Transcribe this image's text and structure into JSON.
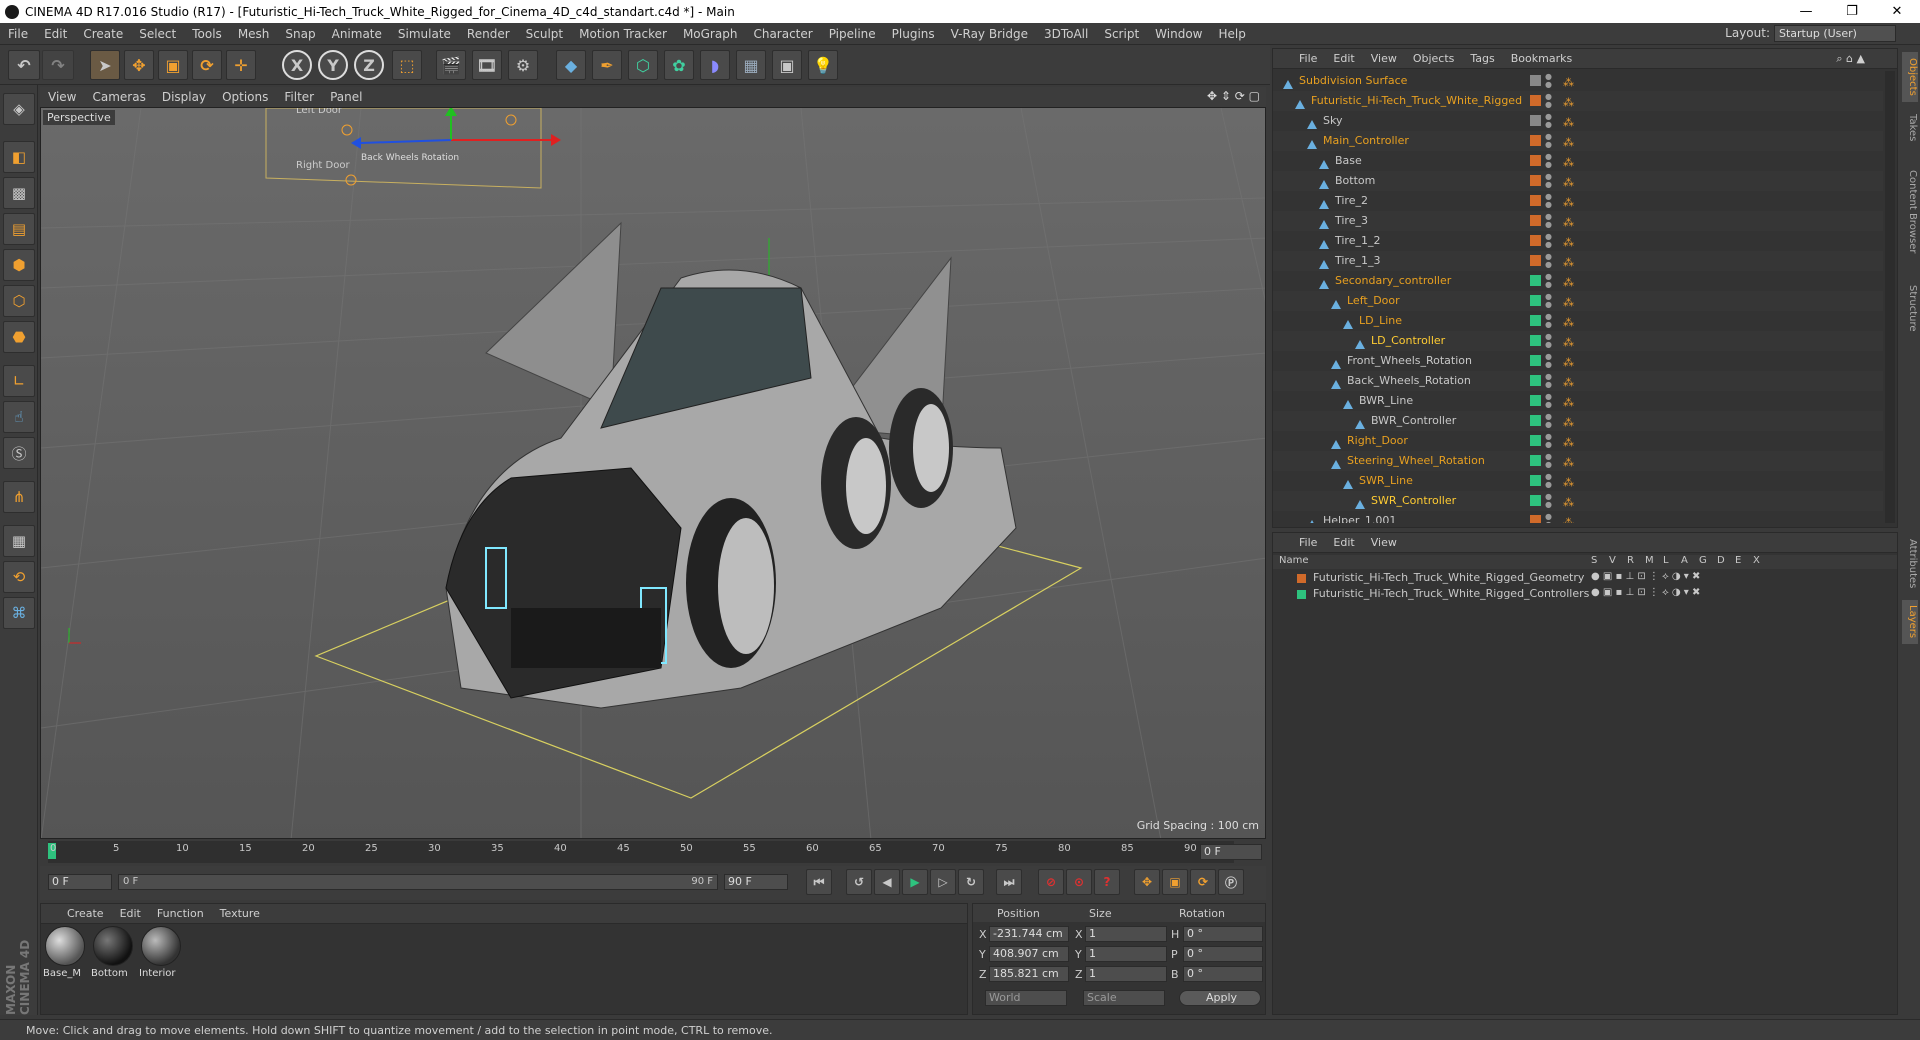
{
  "titlebar": {
    "title": "CINEMA 4D R17.016 Studio (R17) - [Futuristic_Hi-Tech_Truck_White_Rigged_for_Cinema_4D_c4d_standart.c4d *] - Main",
    "minimize": "—",
    "maximize": "❐",
    "close": "✕"
  },
  "menubar": {
    "items": [
      "File",
      "Edit",
      "Create",
      "Select",
      "Tools",
      "Mesh",
      "Snap",
      "Animate",
      "Simulate",
      "Render",
      "Sculpt",
      "Motion Tracker",
      "MoGraph",
      "Character",
      "Pipeline",
      "Plugins",
      "V-Ray Bridge",
      "3DToAll",
      "Script",
      "Window",
      "Help"
    ],
    "layout_label": "Layout:",
    "layout_value": "Startup (User)"
  },
  "toolbar": {
    "icons": [
      "undo-icon",
      "redo-icon",
      "select-arrow-icon",
      "move-icon",
      "scale-icon",
      "rotate-icon",
      "live-select-icon",
      "x-axis-icon",
      "y-axis-icon",
      "z-axis-icon",
      "world-coord-icon",
      "render-view-icon",
      "render-picture-icon",
      "render-settings-icon",
      "cube-icon",
      "pen-icon",
      "subdivision-icon",
      "mograph-icon",
      "deformer-icon",
      "floor-icon",
      "camera-icon",
      "light-icon"
    ],
    "x_label": "X",
    "y_label": "Y",
    "z_label": "Z"
  },
  "viewport": {
    "menu": [
      "View",
      "Cameras",
      "Display",
      "Options",
      "Filter",
      "Panel"
    ],
    "label": "Perspective",
    "grid_spacing": "Grid Spacing : 100 cm",
    "hud_text_1": "Left Door",
    "hud_text_2": "Right Door",
    "hud_text_3": "Back Wheels Rotation"
  },
  "timeline": {
    "ticks": [
      "0",
      "5",
      "10",
      "15",
      "20",
      "25",
      "30",
      "35",
      "40",
      "45",
      "50",
      "55",
      "60",
      "65",
      "70",
      "75",
      "80",
      "85",
      "90"
    ],
    "current_frame": "0 F"
  },
  "transport": {
    "start_field": "0 F",
    "range_start": "0 F",
    "range_end": "90 F",
    "end_field": "90 F"
  },
  "materials": {
    "menu": [
      "Create",
      "Edit",
      "Function",
      "Texture"
    ],
    "items": [
      {
        "name": "Base_M",
        "color": "#8a8a8a"
      },
      {
        "name": "Bottom",
        "color": "#1e1e1e"
      },
      {
        "name": "Interior",
        "color": "#6a6a6a"
      }
    ]
  },
  "coords": {
    "headers": {
      "position": "Position",
      "size": "Size",
      "rotation": "Rotation"
    },
    "rows": [
      {
        "axis": "X",
        "pos": "-231.744 cm",
        "size_axis": "X",
        "size": "1",
        "rot_axis": "H",
        "rot": "0 °"
      },
      {
        "axis": "Y",
        "pos": "408.907 cm",
        "size_axis": "Y",
        "size": "1",
        "rot_axis": "P",
        "rot": "0 °"
      },
      {
        "axis": "Z",
        "pos": "185.821 cm",
        "size_axis": "Z",
        "size": "1",
        "rot_axis": "B",
        "rot": "0 °"
      }
    ],
    "mode": "World",
    "scale": "Scale",
    "apply": "Apply"
  },
  "objects": {
    "menu": [
      "File",
      "Edit",
      "View",
      "Objects",
      "Tags",
      "Bookmarks"
    ],
    "rows": [
      {
        "name": "Subdivision Surface",
        "indent": 0,
        "color": "#e8a020",
        "layer": "#888888"
      },
      {
        "name": "Futuristic_Hi-Tech_Truck_White_Rigged",
        "indent": 1,
        "color": "#e8a020",
        "layer": "#d06a2a"
      },
      {
        "name": "Sky",
        "indent": 2,
        "color": "#c8c8c8",
        "layer": "#888888"
      },
      {
        "name": "Main_Controller",
        "indent": 2,
        "color": "#e8a020",
        "layer": "#d06a2a"
      },
      {
        "name": "Base",
        "indent": 3,
        "color": "#c8c8c8",
        "layer": "#d06a2a"
      },
      {
        "name": "Bottom",
        "indent": 3,
        "color": "#c8c8c8",
        "layer": "#d06a2a"
      },
      {
        "name": "Tire_2",
        "indent": 3,
        "color": "#c8c8c8",
        "layer": "#d06a2a"
      },
      {
        "name": "Tire_3",
        "indent": 3,
        "color": "#c8c8c8",
        "layer": "#d06a2a"
      },
      {
        "name": "Tire_1_2",
        "indent": 3,
        "color": "#c8c8c8",
        "layer": "#d06a2a"
      },
      {
        "name": "Tire_1_3",
        "indent": 3,
        "color": "#c8c8c8",
        "layer": "#d06a2a"
      },
      {
        "name": "Secondary_controller",
        "indent": 3,
        "color": "#e8a020",
        "layer": "#2ec27e"
      },
      {
        "name": "Left_Door",
        "indent": 4,
        "color": "#e8a020",
        "layer": "#2ec27e"
      },
      {
        "name": "LD_Line",
        "indent": 5,
        "color": "#e8a020",
        "layer": "#2ec27e"
      },
      {
        "name": "LD_Controller",
        "indent": 6,
        "color": "#ffcc33",
        "layer": "#2ec27e"
      },
      {
        "name": "Front_Wheels_Rotation",
        "indent": 4,
        "color": "#c8c8c8",
        "layer": "#2ec27e"
      },
      {
        "name": "Back_Wheels_Rotation",
        "indent": 4,
        "color": "#c8c8c8",
        "layer": "#2ec27e"
      },
      {
        "name": "BWR_Line",
        "indent": 5,
        "color": "#c8c8c8",
        "layer": "#2ec27e"
      },
      {
        "name": "BWR_Controller",
        "indent": 6,
        "color": "#c8c8c8",
        "layer": "#2ec27e"
      },
      {
        "name": "Right_Door",
        "indent": 4,
        "color": "#e8a020",
        "layer": "#2ec27e"
      },
      {
        "name": "Steering_Wheel_Rotation",
        "indent": 4,
        "color": "#e8a020",
        "layer": "#2ec27e"
      },
      {
        "name": "SWR_Line",
        "indent": 5,
        "color": "#e8a020",
        "layer": "#2ec27e"
      },
      {
        "name": "SWR_Controller",
        "indent": 6,
        "color": "#ffcc33",
        "layer": "#2ec27e"
      },
      {
        "name": "Helper_1.001",
        "indent": 2,
        "color": "#c8c8c8",
        "layer": "#d06a2a"
      }
    ]
  },
  "layers": {
    "menu": [
      "File",
      "Edit",
      "View"
    ],
    "header_name": "Name",
    "header_cols": [
      "S",
      "V",
      "R",
      "M",
      "L",
      "A",
      "G",
      "D",
      "E",
      "X"
    ],
    "rows": [
      {
        "name": "Futuristic_Hi-Tech_Truck_White_Rigged_Geometry",
        "color": "#d06a2a"
      },
      {
        "name": "Futuristic_Hi-Tech_Truck_White_Rigged_Controllers",
        "color": "#2ec27e"
      }
    ]
  },
  "right_tabs": [
    "Objects",
    "Takes",
    "Content Browser",
    "Structure",
    "Attributes",
    "Layers"
  ],
  "maxon_label": "MAXON CINEMA 4D",
  "status": "Move: Click and drag to move elements. Hold down SHIFT to quantize movement / add to the selection in point mode, CTRL to remove."
}
